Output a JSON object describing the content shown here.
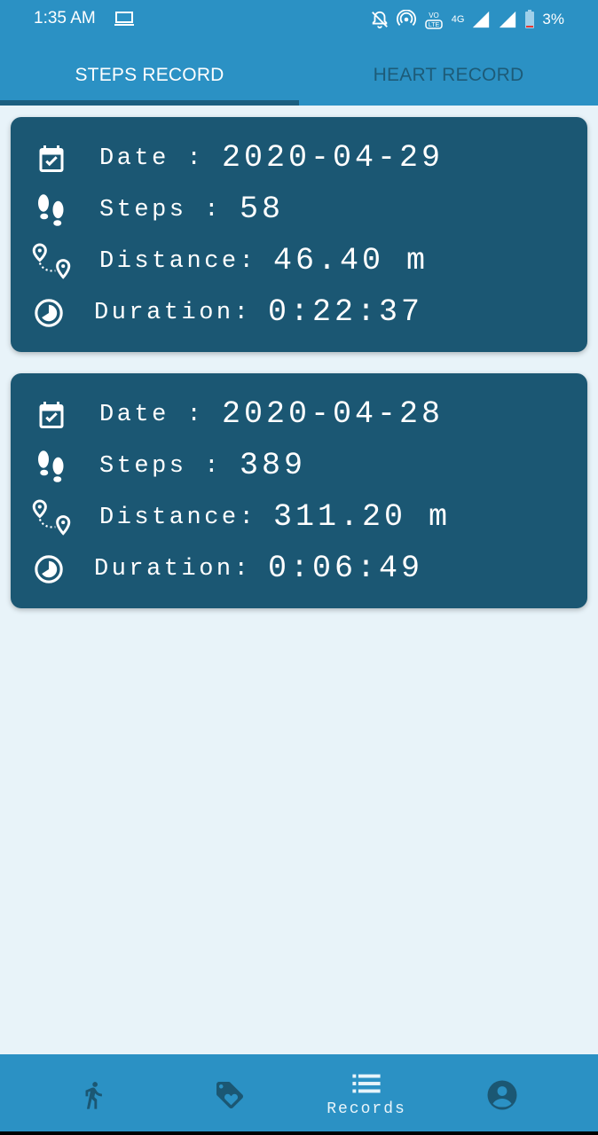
{
  "status_bar": {
    "time": "1:35 AM",
    "battery": "3%",
    "network": "4G"
  },
  "tabs": [
    {
      "label": "STEPS RECORD",
      "active": true
    },
    {
      "label": "HEART RECORD",
      "active": false
    }
  ],
  "records": [
    {
      "date_label": "Date :",
      "date": "2020-04-29",
      "steps_label": "Steps :",
      "steps": "58",
      "distance_label": "Distance:",
      "distance": "46.40 m",
      "duration_label": "Duration:",
      "duration": "0:22:37"
    },
    {
      "date_label": "Date :",
      "date": "2020-04-28",
      "steps_label": "Steps :",
      "steps": "389",
      "distance_label": "Distance:",
      "distance": "311.20 m",
      "duration_label": "Duration:",
      "duration": "0:06:49"
    }
  ],
  "bottom_nav": {
    "items": [
      {
        "icon": "running-icon"
      },
      {
        "icon": "tag-heart-icon"
      },
      {
        "icon": "list-icon",
        "label": "Records",
        "active": true
      },
      {
        "icon": "account-icon"
      }
    ]
  },
  "colors": {
    "primary": "#2b91c4",
    "card": "#1b5773",
    "background": "#e8f3f9",
    "inactive_tab": "#1d5b78"
  }
}
